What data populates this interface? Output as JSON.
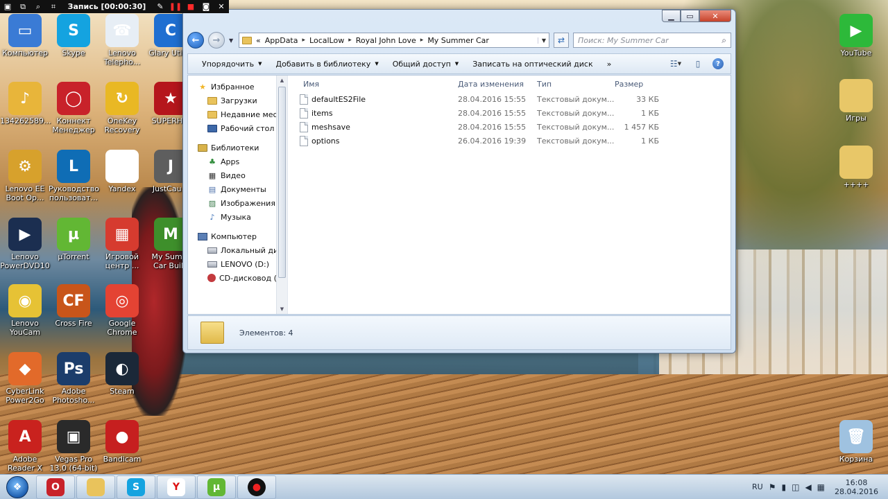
{
  "recorder": {
    "title": "Запись [00:00:30]"
  },
  "desktop": {
    "icons": [
      {
        "label": "Компьютер",
        "color": "#3a7bd5",
        "glyph": "▭"
      },
      {
        "label": "Skype",
        "color": "#14a3e0",
        "glyph": "S"
      },
      {
        "label": "Lenovo Telepho...",
        "color": "#e7eef5",
        "glyph": "☎"
      },
      {
        "label": "Glary Utili s",
        "color": "#1f6fd1",
        "glyph": "C"
      },
      {
        "label": "134262589...",
        "color": "#e8b53a",
        "glyph": "♪"
      },
      {
        "label": "Коннект Менеджер",
        "color": "#c8222a",
        "glyph": "◯"
      },
      {
        "label": "OneKey Recovery",
        "color": "#e9b824",
        "glyph": "↻"
      },
      {
        "label": "SUPERH...",
        "color": "#b5161c",
        "glyph": "★"
      },
      {
        "label": "Lenovo EE Boot Op...",
        "color": "#d7a12c",
        "glyph": "⚙"
      },
      {
        "label": "Руководство пользоват...",
        "color": "#0f6db5",
        "glyph": "L"
      },
      {
        "label": "Yandex",
        "color": "#ffffff",
        "glyph": "Y"
      },
      {
        "label": "JustCau...",
        "color": "#5e5e5e",
        "glyph": "J"
      },
      {
        "label": "Lenovo PowerDVD10",
        "color": "#1b2e50",
        "glyph": "▶"
      },
      {
        "label": "µTorrent",
        "color": "#62b734",
        "glyph": "µ"
      },
      {
        "label": "Игровой центр ...",
        "color": "#d63b2f",
        "glyph": "▦"
      },
      {
        "label": "My Summ Car Build",
        "color": "#3e8f2b",
        "glyph": "M"
      },
      {
        "label": "Lenovo YouCam",
        "color": "#e6c235",
        "glyph": "◉"
      },
      {
        "label": "Cross Fire",
        "color": "#c8551a",
        "glyph": "CF"
      },
      {
        "label": "Google Chrome",
        "color": "#e44333",
        "glyph": "◎"
      },
      {
        "label": "CyberLink Power2Go",
        "color": "#e26a2a",
        "glyph": "◆"
      },
      {
        "label": "Adobe Photosho...",
        "color": "#1c3d6b",
        "glyph": "Ps"
      },
      {
        "label": "Steam",
        "color": "#1b2838",
        "glyph": "◐"
      },
      {
        "label": "Adobe Reader X",
        "color": "#c9221e",
        "glyph": "A"
      },
      {
        "label": "Vegas Pro 13.0 (64-bit)",
        "color": "#2a2a2a",
        "glyph": "▣"
      },
      {
        "label": "Bandicam",
        "color": "#c61f1f",
        "glyph": "●"
      },
      {
        "label": "YouTube",
        "color": "#2db93a",
        "glyph": "▶"
      },
      {
        "label": "Игры",
        "color": "#e8c768",
        "glyph": ""
      },
      {
        "label": "++++",
        "color": "#e8c768",
        "glyph": ""
      },
      {
        "label": "Корзина",
        "color": "#9fc2e0",
        "glyph": "🗑"
      }
    ]
  },
  "explorer": {
    "breadcrumb_prefix": "«",
    "breadcrumbs": [
      "AppData",
      "LocalLow",
      "Royal John Love",
      "My Summer Car"
    ],
    "search_placeholder": "Поиск: My Summer Car",
    "toolbar": {
      "organize": "Упорядочить",
      "add_library": "Добавить в библиотеку",
      "share": "Общий доступ",
      "burn": "Записать на оптический диск",
      "more": "»"
    },
    "nav": {
      "favorites": "Избранное",
      "downloads": "Загрузки",
      "recent": "Недавние места",
      "desktop": "Рабочий стол",
      "libraries": "Библиотеки",
      "apps": "Apps",
      "video": "Видео",
      "documents": "Документы",
      "images": "Изображения",
      "music": "Музыка",
      "computer": "Компьютер",
      "local_disk": "Локальный диск",
      "lenovo": "LENOVO (D:)",
      "cd": "CD-дисковод (E:"
    },
    "columns": {
      "name": "Имя",
      "date": "Дата изменения",
      "type": "Тип",
      "size": "Размер"
    },
    "files": [
      {
        "name": "defaultES2File",
        "date": "28.04.2016 15:55",
        "type": "Текстовый докум...",
        "size": "33 КБ"
      },
      {
        "name": "items",
        "date": "28.04.2016 15:55",
        "type": "Текстовый докум...",
        "size": "1 КБ"
      },
      {
        "name": "meshsave",
        "date": "28.04.2016 15:55",
        "type": "Текстовый докум...",
        "size": "1 457 КБ"
      },
      {
        "name": "options",
        "date": "26.04.2016 19:39",
        "type": "Текстовый докум...",
        "size": "1 КБ"
      }
    ],
    "details": {
      "count_label": "Элементов: 4"
    }
  },
  "taskbar": {
    "language": "RU",
    "time": "16:08",
    "date": "28.04.2016"
  }
}
